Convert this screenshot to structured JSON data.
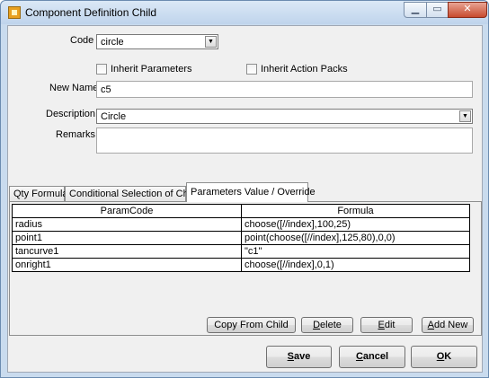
{
  "window": {
    "title": "Component Definition Child",
    "min_glyph": "▁",
    "max_glyph": "▭",
    "close_glyph": "✕"
  },
  "form": {
    "code_label": "Code",
    "code_value": "circle",
    "inherit_parameters_label": "Inherit Parameters",
    "inherit_action_packs_label": "Inherit Action Packs",
    "new_name_label": "New Name",
    "new_name_value": "c5",
    "description_label": "Description",
    "description_value": "Circle",
    "remarks_label": "Remarks",
    "remarks_value": ""
  },
  "tabs": [
    {
      "label": "Qty Formula"
    },
    {
      "label": "Conditional Selection of Child"
    },
    {
      "label": "Parameters Value / Override"
    }
  ],
  "grid": {
    "headers": [
      "ParamCode",
      "Formula"
    ],
    "rows": [
      [
        "radius",
        "choose([//index],100,25)"
      ],
      [
        "point1",
        "point(choose([//index],125,80),0,0)"
      ],
      [
        "tancurve1",
        "\"c1\""
      ],
      [
        "onright1",
        "choose([//index],0,1)"
      ]
    ]
  },
  "panel_buttons": {
    "copy_from_child": {
      "pre": "Copy From Child",
      "u": "",
      "post": ""
    },
    "delete": {
      "pre": "",
      "u": "D",
      "post": "elete"
    },
    "edit": {
      "pre": "",
      "u": "E",
      "post": "dit"
    },
    "add_new": {
      "pre": "",
      "u": "A",
      "post": "dd New"
    }
  },
  "footer_buttons": {
    "save": {
      "pre": "",
      "u": "S",
      "post": "ave"
    },
    "cancel": {
      "pre": "",
      "u": "C",
      "post": "ancel"
    },
    "ok": {
      "pre": "",
      "u": "O",
      "post": "K"
    }
  },
  "icons": {
    "dropdown_arrow": "▼"
  }
}
